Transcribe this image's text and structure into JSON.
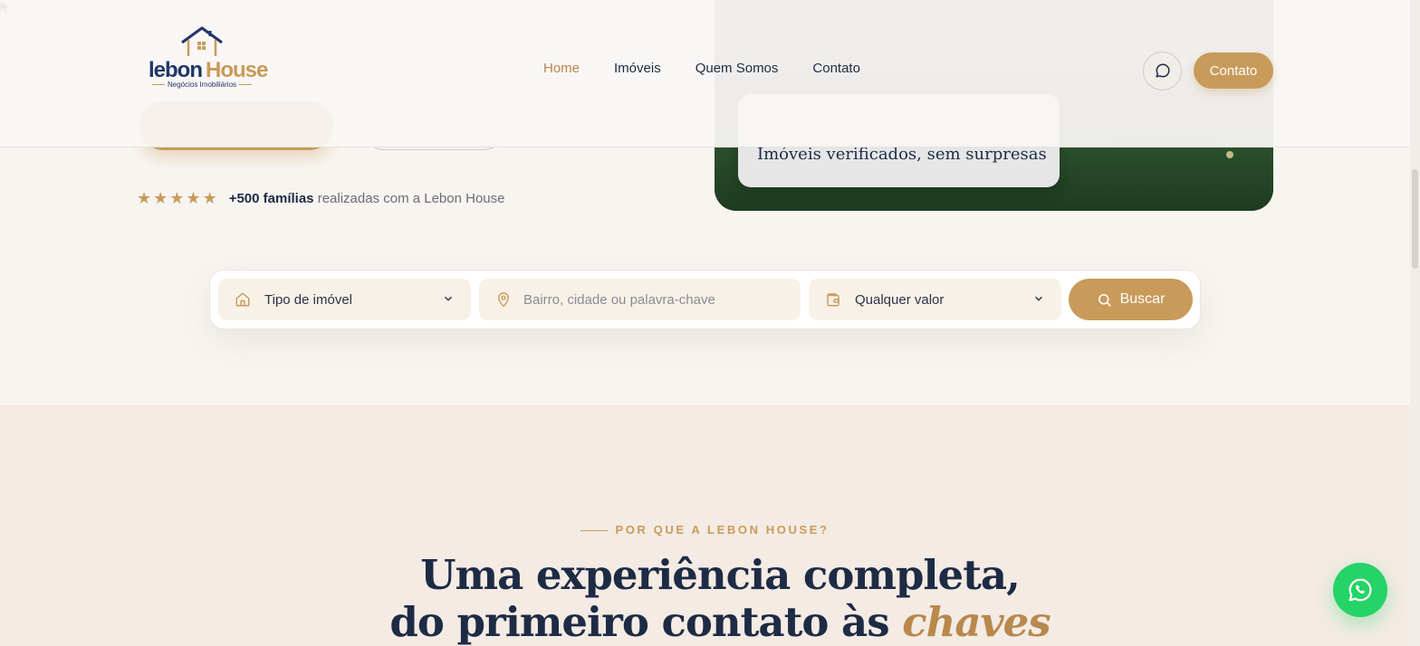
{
  "brand": {
    "logo_main_a": "lebon",
    "logo_main_b": "House",
    "logo_sub": "Negócios Imobiliários",
    "colors": {
      "gold": "#c89b5a",
      "navy": "#1e2b45",
      "whatsapp": "#25d366"
    }
  },
  "nav": {
    "items": [
      {
        "label": "Home",
        "active": true
      },
      {
        "label": "Imóveis"
      },
      {
        "label": "Quem Somos"
      },
      {
        "label": "Contato"
      }
    ],
    "chat_icon": "chat-bubble-icon",
    "cta_label": "Contato"
  },
  "hero": {
    "verified_text": "Imóveis verificados, sem surpresas",
    "rating_stars": 5,
    "rating_strong": "+500 famílias",
    "rating_rest": " realizadas com a Lebon House"
  },
  "search": {
    "type_label": "Tipo de imóvel",
    "type_icon": "home-icon",
    "location_placeholder": "Bairro, cidade ou palavra-chave",
    "location_icon": "map-pin-icon",
    "value_label": "Qualquer valor",
    "value_icon": "wallet-icon",
    "button_label": "Buscar",
    "button_icon": "search-icon"
  },
  "features": {
    "eyebrow": "POR QUE A LEBON HOUSE?",
    "headline_line1": "Uma experiência completa,",
    "headline_line2": "do primeiro contato às ",
    "headline_accent": "chaves"
  },
  "whatsapp_icon": "whatsapp-icon"
}
